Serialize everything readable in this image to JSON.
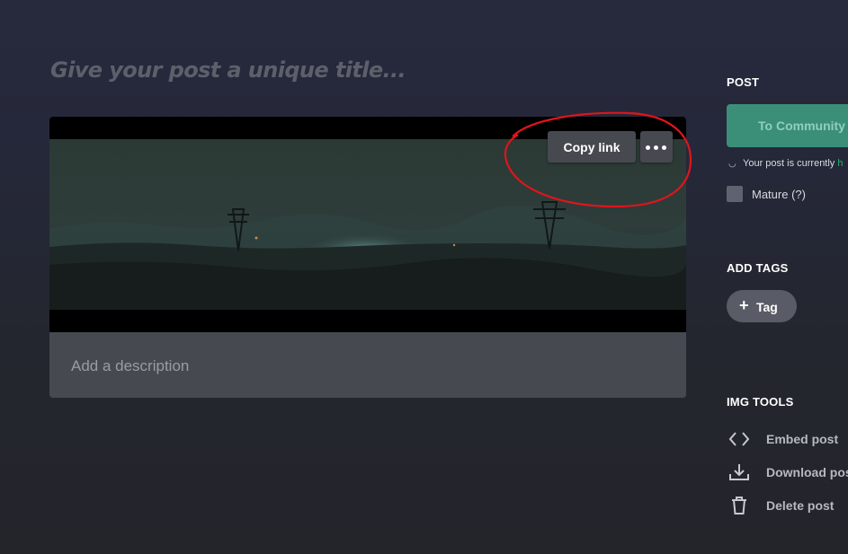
{
  "title_placeholder": "Give your post a unique title...",
  "description_placeholder": "Add a description",
  "media": {
    "copy_link_label": "Copy link"
  },
  "sidebar": {
    "post_heading": "POST",
    "community_button": "To Community",
    "status_prefix": "Your post is currently ",
    "status_suffix": "h",
    "mature_label": "Mature (?)",
    "tags_heading": "ADD TAGS",
    "tag_button": "Tag",
    "tools_heading": "IMG TOOLS",
    "tools": [
      {
        "label": "Embed post",
        "icon": "code-brackets-icon"
      },
      {
        "label": "Download pos",
        "icon": "download-icon"
      },
      {
        "label": "Delete post",
        "icon": "trash-icon"
      }
    ]
  },
  "colors": {
    "accent_green": "#3b8f79",
    "status_green": "#1bb76e",
    "annotation_red": "#e0141c"
  }
}
